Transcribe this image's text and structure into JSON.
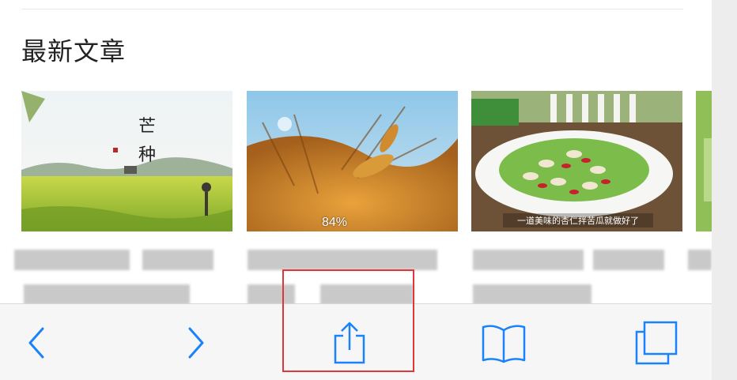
{
  "section": {
    "title": "最新文章"
  },
  "cards": [
    {
      "name": "card-mangzhong",
      "caption_chars": [
        "芒",
        "种"
      ]
    },
    {
      "name": "card-wheat",
      "progress_label": "84%",
      "progress_value": 84
    },
    {
      "name": "card-salad",
      "caption": "一道美味的杏仁拌苦瓜就做好了"
    }
  ],
  "toolbar": {
    "back_icon": "chevron-left-icon",
    "forward_icon": "chevron-right-icon",
    "share_icon": "share-icon",
    "bookmarks_icon": "book-icon",
    "tabs_icon": "tabs-icon"
  },
  "colors": {
    "accent": "#1a82fb",
    "highlight": "#e0353a"
  }
}
